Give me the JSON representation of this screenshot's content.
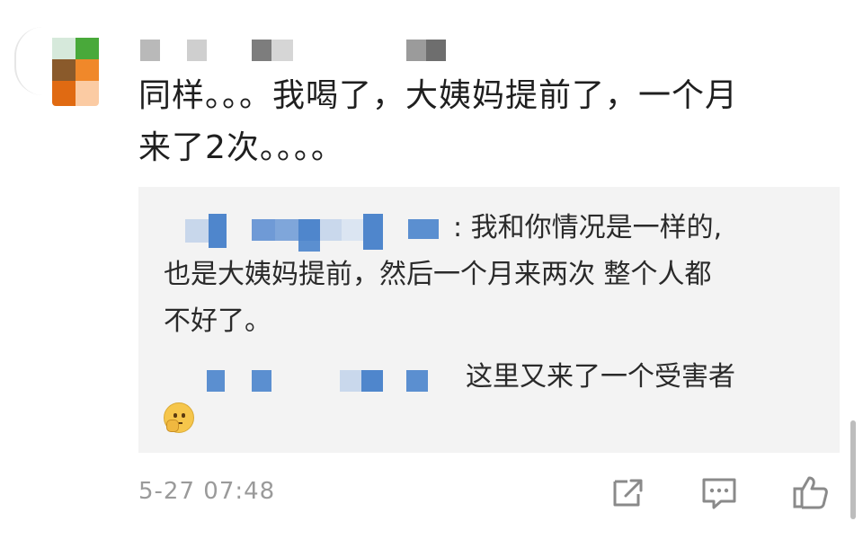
{
  "comment": {
    "line1": "同样。。。我喝了，大姨妈提前了，一个月",
    "line2": "来了2次。。。。"
  },
  "reply": {
    "first_line": ": 我和你情况是一样的,",
    "line2": "也是大姨妈提前，然后一个月来两次 整个人都",
    "line3": "不好了。"
  },
  "reply2": {
    "text": "这里又来了一个受害者"
  },
  "footer": {
    "timestamp": "5-27 07:48"
  },
  "icons": {
    "share": "share-icon",
    "comment": "comment-icon",
    "like": "thumbs-up-icon",
    "emoji": "thinking-face-icon"
  },
  "colors": {
    "reply_bg": "#f3f3f3",
    "pixel_blue": "#5b8fd0",
    "pixel_gray": "#8a8a8a",
    "timestamp": "#9a9a9a"
  }
}
